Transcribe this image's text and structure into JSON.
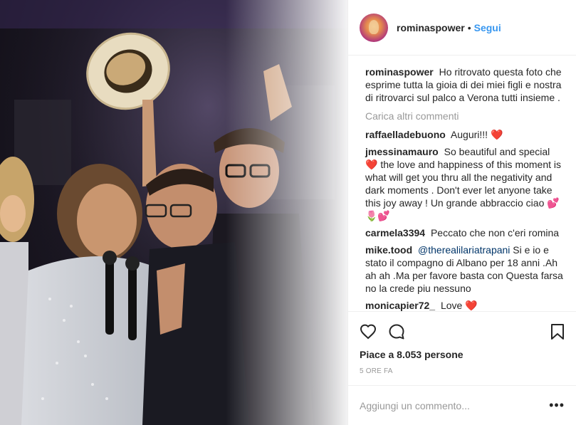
{
  "header": {
    "username": "rominaspower",
    "separator": "•",
    "follow_label": "Segui"
  },
  "caption": {
    "username": "rominaspower",
    "text": "Ho ritrovato questa foto che esprime tutta la gioia di dei miei figli e nostra di ritrovarci sul palco a Verona tutti insieme ."
  },
  "load_more": "Carica altri commenti",
  "comments": [
    {
      "username": "raffaelladebuono",
      "text": "Auguri!!!",
      "emoji": "❤️"
    },
    {
      "username": "jmessinamauro",
      "text": "So beautiful and special ❤️ the love and happiness of this moment is what will get you thru all the negativity and dark moments . Don't ever let anyone take this joy away ! Un grande abbraccio ciao 💕🌷💕"
    },
    {
      "username": "carmela3394",
      "text": "Peccato che non c'eri romina"
    },
    {
      "username": "mike.tood",
      "mention": "@therealilariatrapani",
      "text": "Si e io e stato il compagno di Albano per 18 anni .Ah ah ah .Ma per favore basta con Questa farsa no la crede piu nessuno"
    },
    {
      "username": "monicapier72_",
      "text": "Love",
      "emoji": "❤️"
    }
  ],
  "likes_text": "Piace a 8.053 persone",
  "timestamp": "5 ORE FA",
  "add_comment": {
    "placeholder": "Aggiungi un commento...",
    "more": "•••"
  },
  "icons": {
    "like": "heart-outline-icon",
    "comment": "comment-bubble-icon",
    "save": "bookmark-icon",
    "more": "more-dots-icon"
  },
  "colors": {
    "link": "#3897f0",
    "heart": "#ed4956",
    "mention": "#003569",
    "muted": "#999999"
  }
}
